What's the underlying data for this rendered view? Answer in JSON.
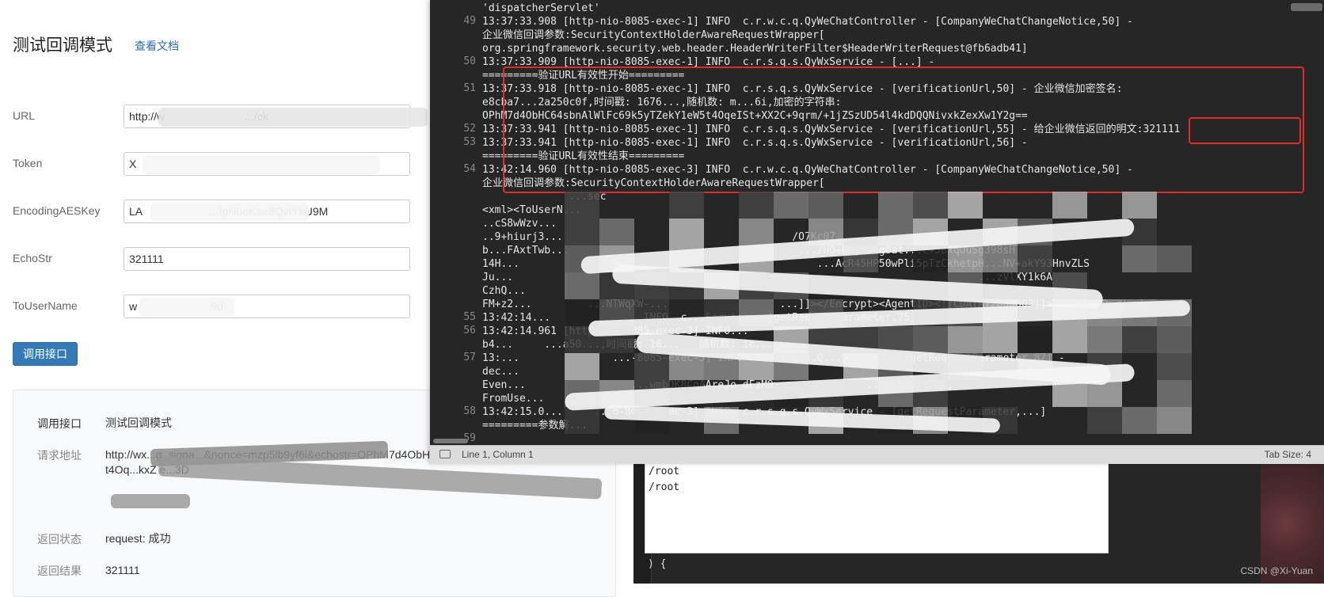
{
  "left_page": {
    "title": "测试回调模式",
    "doc_link": "查看文档",
    "fields": [
      {
        "label": "URL",
        "value": "http://w                          .../ck"
      },
      {
        "label": "Token",
        "value": "X"
      },
      {
        "label": "EncodingAESKey",
        "value": "LA                      ...fpN0eKae8QvIYkU9M"
      },
      {
        "label": "EchoStr",
        "value": "321111"
      },
      {
        "label": "ToUserName",
        "value": "w                        9d"
      }
    ],
    "call_button": "调用接口",
    "result": {
      "row1_key": "调用接口",
      "row1_val": "测试回调模式",
      "row2_key": "请求地址",
      "row2_val": "http://wx...g_signa...&nonce=mzp5lb9yf6i&echostr=OPhM7d4ObHC64sbnAlWlFc69k5yTZekY1eW5t4Oq...kxZ e...3D",
      "row3_key": "返回状态",
      "row3_val": "request: 成功",
      "row4_key": "返回结果",
      "row4_val": "321111"
    }
  },
  "editor": {
    "status_position": "Line 1, Column 1",
    "status_tab_size": "Tab Size: 4",
    "lines": [
      {
        "n": "",
        "text": "'dispatcherServlet'"
      },
      {
        "n": "49",
        "text": "13:37:33.908 [http-nio-8085-exec-1] INFO  c.r.w.c.q.QyWeChatController - [CompanyWeChatChangeNotice,50] -"
      },
      {
        "n": "",
        "text": "企业微信回调参数:SecurityContextHolderAwareRequestWrapper["
      },
      {
        "n": "",
        "text": "org.springframework.security.web.header.HeaderWriterFilter$HeaderWriterRequest@fb6adb41]"
      },
      {
        "n": "50",
        "text": "13:37:33.909 [http-nio-8085-exec-1] INFO  c.r.s.q.s.QyWxService - [...] -"
      },
      {
        "n": "",
        "text": "=========验证URL有效性开始========="
      },
      {
        "n": "51",
        "text": "13:37:33.918 [http-nio-8085-exec-1] INFO  c.r.s.q.s.QyWxService - [verificationUrl,50] - 企业微信加密签名:"
      },
      {
        "n": "",
        "text": "e8cba7...2a250c0f,时间戳: 1676...,随机数: m...6i,加密的字符串:"
      },
      {
        "n": "",
        "text": "OPhM7d4ObHC64sbnAlWlFc69k5yTZekY1eW5t4OqeISt+XX2C+9qrm/+1jZSzUD54l4kdDQQNivxkZexXw1Y2g=="
      },
      {
        "n": "52",
        "text": "13:37:33.941 [http-nio-8085-exec-1] INFO  c.r.s.q.s.QyWxService - [verificationUrl,55] - 给企业微信返回的明文:321111"
      },
      {
        "n": "53",
        "text": "13:37:33.941 [http-nio-8085-exec-1] INFO  c.r.s.q.s.QyWxService - [verificationUrl,56] -"
      },
      {
        "n": "",
        "text": "=========验证URL有效性结束========="
      },
      {
        "n": "54",
        "text": "13:42:14.960 [http-nio-8085-exec-3] INFO  c.r.w.c.q.QyWeChatController - [CompanyWeChatChangeNotice,50] -"
      },
      {
        "n": "",
        "text": "企业微信回调参数:SecurityContextHolderAwareRequestWrapper["
      },
      {
        "n": "",
        "text": "              ...sec"
      },
      {
        "n": "",
        "text": "<xml><ToUserN..."
      },
      {
        "n": "",
        "text": "..cS8wWzv..."
      },
      {
        "n": "",
        "text": "..9+hiurj3...                                     /O7Kc07..."
      },
      {
        "n": "",
        "text": "b...FAxtTwb...                                     .../HQ+KljZssg0at...C+JBxqUuSg398sH"
      },
      {
        "n": "",
        "text": "14H...                                                ...AcR45HP50wPli5pTzCkhetpH...NV+akY93HnvZLS"
      },
      {
        "n": "",
        "text": "Ju...                                                                           ...zVlXY1k6A"
      },
      {
        "n": "",
        "text": "CzhQ..."
      },
      {
        "n": "",
        "text": "FM+z2...         ...NTWqXW-...                  ...]]></Encrypt><AgentID><![CDATA[2000003]]></AgentID></xml>"
      },
      {
        "n": "55",
        "text": "13:42:14...               INFO  c...Service - [getRequestParameter,75] ..."
      },
      {
        "n": "56",
        "text": "13:42:14.961 [http-nio-8085-exec-3] INFO..."
      },
      {
        "n": "",
        "text": "b4...     ...a50...,时间戳: 16...   随机数: 1c..."
      },
      {
        "n": "57",
        "text": "13:...               ...-8085-exec-3] INFO  c.r.s.q.s.Q...Service - [getRequestParameter,87] -"
      },
      {
        "n": "",
        "text": "dec..."
      },
      {
        "n": "",
        "text": "Even...                 ...wmbDK8CgAAreJo_dFzM9Fe...          ...efb99f6f9d,"
      },
      {
        "n": "",
        "text": "FromUse...                 ...}"
      },
      {
        "n": "58",
        "text": "13:42:15.0...     ...o-8085-exec-3] INFO  c.r.s.q.s.QyWxService - [getRequestParameter,...]"
      },
      {
        "n": "",
        "text": "=========参数解..."
      },
      {
        "n": "59",
        "text": ""
      }
    ]
  },
  "background": {
    "panel_lines": [
      "/root",
      "/root"
    ],
    "code_text": ") {"
  },
  "watermark": "CSDN @Xi-Yuan",
  "colors": {
    "highlight_red": "#e02b2b",
    "link_blue": "#2a6db5",
    "button_blue": "#337ab7",
    "editor_bg": "#262626"
  }
}
